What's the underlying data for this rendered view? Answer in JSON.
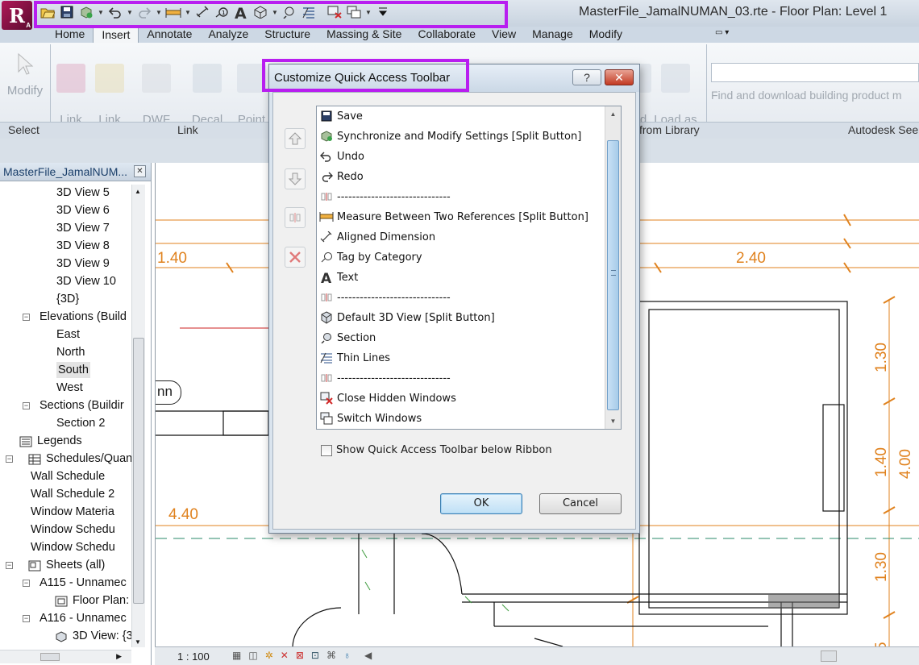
{
  "window": {
    "title": "MasterFile_JamalNUMAN_03.rte - Floor Plan: Level 1",
    "logo_letter": "R",
    "logo_sub": "A"
  },
  "ribbon_tabs": [
    "Home",
    "Insert",
    "Annotate",
    "Analyze",
    "Structure",
    "Massing & Site",
    "Collaborate",
    "View",
    "Manage",
    "Modify"
  ],
  "ribbon": {
    "buttons": [
      {
        "label": "Modify"
      },
      {
        "label": "Link\nRevit"
      },
      {
        "label": "Link\nCAD"
      },
      {
        "label": "DWF\nMarkup"
      },
      {
        "label": "Decal"
      },
      {
        "label": "Point\nCloud"
      },
      {
        "label": "d\nily"
      },
      {
        "label": "Load as\nGroup"
      }
    ],
    "panels": [
      "Select",
      "Link",
      "from Library",
      "Autodesk See"
    ],
    "search_hint": "Find and download building product m"
  },
  "project_browser": {
    "title": "MasterFile_JamalNUM...",
    "items": [
      {
        "label": "3D View 5",
        "level": 3
      },
      {
        "label": "3D View 6",
        "level": 3
      },
      {
        "label": "3D View 7",
        "level": 3
      },
      {
        "label": "3D View 8",
        "level": 3
      },
      {
        "label": "3D View 9",
        "level": 3
      },
      {
        "label": "3D View 10",
        "level": 3
      },
      {
        "label": "{3D}",
        "level": 3
      },
      {
        "label": "Elevations (Build",
        "level": 2,
        "toggle": "−"
      },
      {
        "label": "East",
        "level": 3
      },
      {
        "label": "North",
        "level": 3
      },
      {
        "label": "South",
        "level": 3,
        "selected": true
      },
      {
        "label": "West",
        "level": 3
      },
      {
        "label": "Sections (Buildir",
        "level": 2,
        "toggle": "−"
      },
      {
        "label": "Section 2",
        "level": 3
      },
      {
        "label": "Legends",
        "level": 1,
        "icon": "legend"
      },
      {
        "label": "Schedules/Quant",
        "level": 1,
        "icon": "schedule",
        "toggle": "−"
      },
      {
        "label": "Wall Schedule",
        "level": 2
      },
      {
        "label": "Wall Schedule 2",
        "level": 2
      },
      {
        "label": "Window Materia",
        "level": 2
      },
      {
        "label": "Window Schedu",
        "level": 2
      },
      {
        "label": "Window Schedu",
        "level": 2
      },
      {
        "label": "Sheets (all)",
        "level": 1,
        "icon": "sheet",
        "toggle": "−"
      },
      {
        "label": "A115 - Unnamec",
        "level": 2,
        "toggle": "−"
      },
      {
        "label": "Floor Plan:",
        "level": 3,
        "icon": "plan"
      },
      {
        "label": "A116 - Unnamec",
        "level": 2,
        "toggle": "−"
      },
      {
        "label": "3D View: {3",
        "level": 3,
        "icon": "view3d"
      }
    ]
  },
  "drawing": {
    "dims": [
      "1.40",
      "2.40",
      "4.40",
      "1.30",
      "1.40",
      "1.30",
      "4.00",
      "5"
    ],
    "tag": "nn"
  },
  "statusbar": {
    "scale": "1 : 100"
  },
  "dialog": {
    "title": "Customize Quick Access Toolbar",
    "help": "?",
    "close": "✕",
    "items": [
      {
        "icon": "save",
        "label": "Save"
      },
      {
        "icon": "sync",
        "label": "Synchronize and Modify Settings [Split Button]"
      },
      {
        "icon": "undo",
        "label": "Undo"
      },
      {
        "icon": "redo",
        "label": "Redo"
      },
      {
        "icon": "separator",
        "label": "------------------------------"
      },
      {
        "icon": "measure",
        "label": "Measure Between Two References [Split Button]"
      },
      {
        "icon": "aligned-dim",
        "label": "Aligned Dimension"
      },
      {
        "icon": "tag",
        "label": "Tag by Category"
      },
      {
        "icon": "text",
        "label": "Text"
      },
      {
        "icon": "separator",
        "label": "------------------------------"
      },
      {
        "icon": "3d-view",
        "label": "Default 3D View [Split Button]"
      },
      {
        "icon": "section",
        "label": "Section"
      },
      {
        "icon": "thin-lines",
        "label": "Thin Lines"
      },
      {
        "icon": "separator",
        "label": "------------------------------"
      },
      {
        "icon": "close-hidden",
        "label": "Close Hidden Windows"
      },
      {
        "icon": "switch-windows",
        "label": "Switch Windows"
      }
    ],
    "checkbox_label": "Show Quick Access Toolbar below Ribbon",
    "checkbox_checked": false,
    "ok": "OK",
    "cancel": "Cancel"
  },
  "colors": {
    "highlight": "#b81ef0",
    "dimension": "#e0821e",
    "accent": "#3c7fb1"
  }
}
